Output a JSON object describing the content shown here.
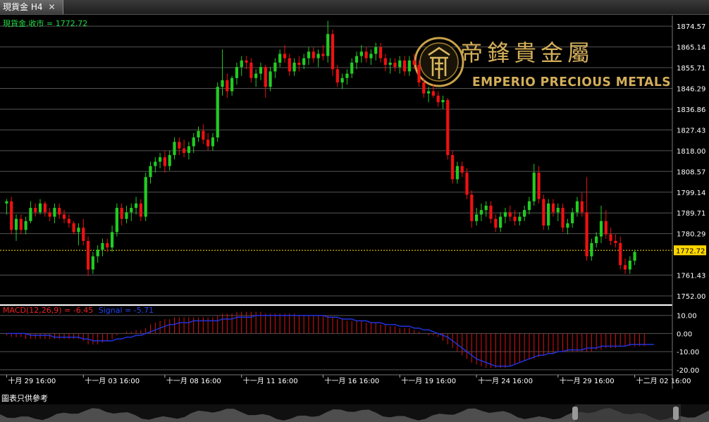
{
  "window": {
    "tab_title": "現貨金 H4",
    "close_glyph": "✕"
  },
  "header_label": "現貨金.收市 = 1772.72",
  "logo": {
    "cn": "帝鋒貴金屬",
    "en": "EMPERIO PRECIOUS METALS"
  },
  "footer_note": "圖表只供參考",
  "colors": {
    "up": "#22cc22",
    "down": "#ee1111",
    "grid": "#555555",
    "current": "#ffd700",
    "macd_line": "#2233dd",
    "macd_hist": "#dd1111"
  },
  "chart_data": [
    {
      "type": "candlestick",
      "title": "現貨金.收市 = 1772.72",
      "timeframe": "H4",
      "y_ticks": [
        "1874.57",
        "1865.14",
        "1855.71",
        "1846.29",
        "1836.86",
        "1827.43",
        "1818.00",
        "1808.57",
        "1799.14",
        "1789.71",
        "1780.29",
        "1772.72",
        "1761.43",
        "1752.00"
      ],
      "current_price": 1772.72,
      "ylim": [
        1752.0,
        1877.5
      ],
      "x_ticks": [
        "十月 29 16:00",
        "十一月 03 16:00",
        "十一月 08 16:00",
        "十一月 11 16:00",
        "十一月 16 16:00",
        "十一月 19 16:00",
        "十一月 24 16:00",
        "十一月 29 16:00",
        "十二月 02 16:00"
      ],
      "grid": true,
      "series_ohlc": [
        [
          1794,
          1796,
          1789,
          1795
        ],
        [
          1795,
          1797,
          1780,
          1782
        ],
        [
          1782,
          1789,
          1777,
          1787
        ],
        [
          1787,
          1789,
          1780,
          1782
        ],
        [
          1782,
          1788,
          1780,
          1786
        ],
        [
          1786,
          1795,
          1785,
          1792
        ],
        [
          1792,
          1794,
          1788,
          1790
        ],
        [
          1790,
          1796,
          1789,
          1794
        ],
        [
          1794,
          1795,
          1788,
          1790
        ],
        [
          1790,
          1792,
          1786,
          1788
        ],
        [
          1788,
          1794,
          1785,
          1792
        ],
        [
          1792,
          1794,
          1787,
          1789
        ],
        [
          1789,
          1791,
          1785,
          1787
        ],
        [
          1787,
          1789,
          1783,
          1785
        ],
        [
          1785,
          1786,
          1780,
          1781
        ],
        [
          1781,
          1785,
          1775,
          1783
        ],
        [
          1783,
          1787,
          1775,
          1777
        ],
        [
          1777,
          1779,
          1761,
          1764
        ],
        [
          1764,
          1772,
          1762,
          1770
        ],
        [
          1770,
          1775,
          1767,
          1773
        ],
        [
          1773,
          1778,
          1770,
          1776
        ],
        [
          1776,
          1778,
          1772,
          1774
        ],
        [
          1774,
          1784,
          1772,
          1781
        ],
        [
          1781,
          1794,
          1779,
          1792
        ],
        [
          1792,
          1794,
          1784,
          1787
        ],
        [
          1787,
          1793,
          1785,
          1790
        ],
        [
          1790,
          1794,
          1786,
          1792
        ],
        [
          1792,
          1797,
          1789,
          1794
        ],
        [
          1794,
          1796,
          1786,
          1788
        ],
        [
          1788,
          1808,
          1786,
          1806
        ],
        [
          1806,
          1813,
          1803,
          1811
        ],
        [
          1811,
          1815,
          1808,
          1813
        ],
        [
          1813,
          1817,
          1810,
          1815
        ],
        [
          1815,
          1818,
          1808,
          1811
        ],
        [
          1811,
          1818,
          1809,
          1816
        ],
        [
          1816,
          1824,
          1814,
          1822
        ],
        [
          1822,
          1824,
          1816,
          1819
        ],
        [
          1819,
          1823,
          1815,
          1817
        ],
        [
          1817,
          1822,
          1814,
          1820
        ],
        [
          1820,
          1826,
          1817,
          1824
        ],
        [
          1824,
          1829,
          1822,
          1827
        ],
        [
          1827,
          1830,
          1821,
          1823
        ],
        [
          1823,
          1826,
          1818,
          1820
        ],
        [
          1820,
          1826,
          1818,
          1824
        ],
        [
          1824,
          1849,
          1822,
          1847
        ],
        [
          1847,
          1864,
          1843,
          1850
        ],
        [
          1850,
          1853,
          1842,
          1845
        ],
        [
          1845,
          1852,
          1843,
          1851
        ],
        [
          1851,
          1858,
          1848,
          1856
        ],
        [
          1856,
          1861,
          1852,
          1859
        ],
        [
          1859,
          1861,
          1855,
          1858
        ],
        [
          1858,
          1860,
          1849,
          1851
        ],
        [
          1851,
          1855,
          1847,
          1853
        ],
        [
          1853,
          1858,
          1850,
          1856
        ],
        [
          1856,
          1857,
          1842,
          1847
        ],
        [
          1847,
          1856,
          1845,
          1854
        ],
        [
          1854,
          1860,
          1851,
          1858
        ],
        [
          1858,
          1864,
          1856,
          1862
        ],
        [
          1862,
          1866,
          1858,
          1860
        ],
        [
          1860,
          1862,
          1852,
          1854
        ],
        [
          1854,
          1860,
          1852,
          1858
        ],
        [
          1858,
          1861,
          1854,
          1857
        ],
        [
          1857,
          1862,
          1855,
          1860
        ],
        [
          1860,
          1865,
          1857,
          1863
        ],
        [
          1863,
          1865,
          1858,
          1860
        ],
        [
          1860,
          1864,
          1856,
          1862
        ],
        [
          1862,
          1866,
          1859,
          1861
        ],
        [
          1861,
          1877,
          1858,
          1871
        ],
        [
          1871,
          1873,
          1852,
          1855
        ],
        [
          1855,
          1857,
          1847,
          1849
        ],
        [
          1849,
          1853,
          1846,
          1851
        ],
        [
          1851,
          1855,
          1848,
          1853
        ],
        [
          1853,
          1860,
          1851,
          1858
        ],
        [
          1858,
          1863,
          1855,
          1861
        ],
        [
          1861,
          1866,
          1858,
          1863
        ],
        [
          1863,
          1865,
          1858,
          1860
        ],
        [
          1860,
          1864,
          1857,
          1862
        ],
        [
          1862,
          1867,
          1859,
          1865
        ],
        [
          1865,
          1867,
          1858,
          1860
        ],
        [
          1860,
          1862,
          1854,
          1857
        ],
        [
          1857,
          1860,
          1853,
          1858
        ],
        [
          1858,
          1860,
          1854,
          1856
        ],
        [
          1856,
          1861,
          1853,
          1859
        ],
        [
          1859,
          1861,
          1852,
          1854
        ],
        [
          1854,
          1861,
          1852,
          1859
        ],
        [
          1859,
          1862,
          1855,
          1857
        ],
        [
          1857,
          1859,
          1847,
          1849
        ],
        [
          1849,
          1851,
          1842,
          1844
        ],
        [
          1844,
          1847,
          1840,
          1845
        ],
        [
          1845,
          1848,
          1842,
          1843
        ],
        [
          1843,
          1845,
          1838,
          1840
        ],
        [
          1840,
          1843,
          1837,
          1841
        ],
        [
          1841,
          1842,
          1814,
          1816
        ],
        [
          1816,
          1818,
          1803,
          1805
        ],
        [
          1805,
          1813,
          1803,
          1811
        ],
        [
          1811,
          1813,
          1806,
          1808
        ],
        [
          1808,
          1810,
          1796,
          1798
        ],
        [
          1798,
          1800,
          1783,
          1786
        ],
        [
          1786,
          1792,
          1784,
          1789
        ],
        [
          1789,
          1794,
          1786,
          1791
        ],
        [
          1791,
          1795,
          1788,
          1793
        ],
        [
          1793,
          1795,
          1785,
          1787
        ],
        [
          1787,
          1789,
          1781,
          1783
        ],
        [
          1783,
          1790,
          1781,
          1788
        ],
        [
          1788,
          1792,
          1785,
          1790
        ],
        [
          1790,
          1793,
          1786,
          1788
        ],
        [
          1788,
          1791,
          1784,
          1786
        ],
        [
          1786,
          1790,
          1784,
          1788
        ],
        [
          1788,
          1793,
          1786,
          1791
        ],
        [
          1791,
          1797,
          1789,
          1795
        ],
        [
          1795,
          1812,
          1793,
          1808
        ],
        [
          1808,
          1811,
          1794,
          1796
        ],
        [
          1796,
          1798,
          1782,
          1784
        ],
        [
          1784,
          1796,
          1782,
          1794
        ],
        [
          1794,
          1796,
          1788,
          1790
        ],
        [
          1790,
          1794,
          1786,
          1792
        ],
        [
          1792,
          1794,
          1781,
          1783
        ],
        [
          1783,
          1787,
          1780,
          1785
        ],
        [
          1785,
          1792,
          1783,
          1790
        ],
        [
          1790,
          1797,
          1788,
          1795
        ],
        [
          1795,
          1799,
          1788,
          1790
        ],
        [
          1790,
          1806,
          1768,
          1770
        ],
        [
          1770,
          1778,
          1768,
          1776
        ],
        [
          1776,
          1781,
          1774,
          1779
        ],
        [
          1779,
          1793,
          1776,
          1786
        ],
        [
          1786,
          1791,
          1778,
          1780
        ],
        [
          1780,
          1783,
          1775,
          1777
        ],
        [
          1777,
          1780,
          1774,
          1776
        ],
        [
          1776,
          1779,
          1764,
          1766
        ],
        [
          1766,
          1769,
          1762,
          1764
        ],
        [
          1764,
          1770,
          1762,
          1768
        ],
        [
          1768,
          1773,
          1766,
          1772
        ]
      ]
    },
    {
      "type": "line+histogram",
      "title": "MACD(12,26,9) = -6.45",
      "title_signal": "Signal = -5.71",
      "y_ticks": [
        "10.00",
        "0.00",
        "-10.00",
        "-20.00"
      ],
      "ylim": [
        -22,
        13
      ],
      "macd_hist": [
        -1,
        -2,
        -2,
        -2,
        -3,
        -3,
        -3,
        -3,
        -3,
        -3,
        -3,
        -3,
        -3,
        -3,
        -3,
        -3,
        -4,
        -6,
        -6,
        -6,
        -5,
        -4,
        -3,
        -1,
        0,
        1,
        1,
        2,
        2,
        3,
        5,
        6,
        7,
        8,
        8,
        9,
        9,
        9,
        9,
        9,
        9,
        9,
        9,
        9,
        10,
        11,
        11,
        11,
        12,
        12,
        12,
        12,
        12,
        12,
        11,
        11,
        11,
        11,
        11,
        11,
        11,
        10,
        10,
        10,
        10,
        10,
        10,
        10,
        9,
        8,
        8,
        7,
        7,
        7,
        7,
        6,
        6,
        6,
        5,
        5,
        4,
        4,
        3,
        3,
        3,
        2,
        1,
        0,
        -1,
        -1,
        -2,
        -4,
        -6,
        -8,
        -10,
        -12,
        -14,
        -16,
        -17,
        -18,
        -19,
        -19,
        -19,
        -19,
        -19,
        -18,
        -17,
        -16,
        -15,
        -14,
        -14,
        -13,
        -12,
        -11,
        -11,
        -10,
        -10,
        -10,
        -10,
        -10,
        -10,
        -10,
        -10,
        -9,
        -9,
        -8,
        -8,
        -8,
        -7,
        -7,
        -7,
        -7,
        -7,
        -7
      ],
      "signal_line": [
        0,
        0,
        0,
        0,
        0,
        -1,
        -1,
        -1,
        -1,
        -1,
        -2,
        -2,
        -2,
        -2,
        -2,
        -2,
        -3,
        -3,
        -4,
        -4,
        -4,
        -4,
        -4,
        -3,
        -3,
        -2,
        -2,
        -1,
        -1,
        0,
        1,
        2,
        3,
        4,
        5,
        5,
        6,
        6,
        6,
        7,
        7,
        7,
        7,
        7,
        7,
        8,
        8,
        8,
        9,
        9,
        9,
        9,
        10,
        10,
        10,
        10,
        10,
        10,
        10,
        10,
        10,
        10,
        10,
        10,
        10,
        10,
        10,
        9,
        9,
        9,
        8,
        8,
        8,
        7,
        7,
        7,
        6,
        6,
        6,
        5,
        5,
        5,
        4,
        4,
        4,
        3,
        3,
        2,
        2,
        1,
        0,
        -1,
        -2,
        -4,
        -6,
        -8,
        -10,
        -12,
        -14,
        -15,
        -16,
        -17,
        -18,
        -18,
        -18,
        -18,
        -17,
        -16,
        -15,
        -14,
        -13,
        -12,
        -12,
        -11,
        -11,
        -10,
        -10,
        -9,
        -9,
        -9,
        -9,
        -8,
        -8,
        -8,
        -7,
        -7,
        -7,
        -7,
        -7,
        -7,
        -6,
        -6,
        -6,
        -6,
        -6,
        -6
      ],
      "grid": true
    }
  ]
}
